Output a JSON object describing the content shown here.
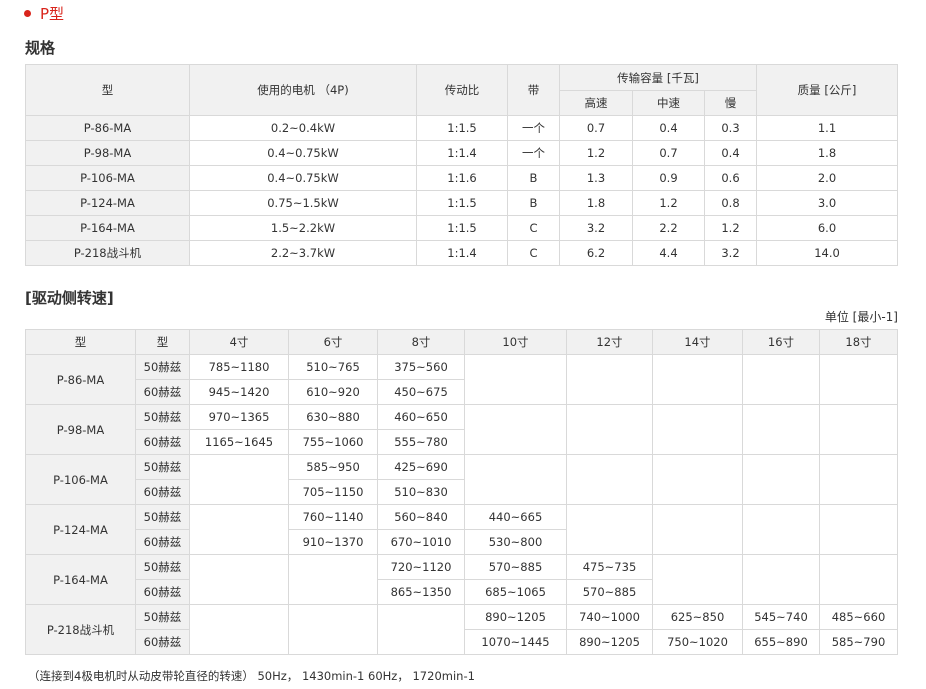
{
  "page_type_label": "P型",
  "spec_title": "规格",
  "spec_table": {
    "headers": {
      "model": "型",
      "motor": "使用的电机 （4P)",
      "ratio": "传动比",
      "belt": "带",
      "capacity": "传输容量 [千瓦]",
      "high": "高速",
      "mid": "中速",
      "low": "慢",
      "mass": "质量 [公斤]"
    },
    "rows": [
      {
        "model": "P-86-MA",
        "motor": "0.2~0.4kW",
        "ratio": "1:1.5",
        "belt": "一个",
        "high": "0.7",
        "mid": "0.4",
        "low": "0.3",
        "mass": "1.1"
      },
      {
        "model": "P-98-MA",
        "motor": "0.4~0.75kW",
        "ratio": "1:1.4",
        "belt": "一个",
        "high": "1.2",
        "mid": "0.7",
        "low": "0.4",
        "mass": "1.8"
      },
      {
        "model": "P-106-MA",
        "motor": "0.4~0.75kW",
        "ratio": "1:1.6",
        "belt": "B",
        "high": "1.3",
        "mid": "0.9",
        "low": "0.6",
        "mass": "2.0"
      },
      {
        "model": "P-124-MA",
        "motor": "0.75~1.5kW",
        "ratio": "1:1.5",
        "belt": "B",
        "high": "1.8",
        "mid": "1.2",
        "low": "0.8",
        "mass": "3.0"
      },
      {
        "model": "P-164-MA",
        "motor": "1.5~2.2kW",
        "ratio": "1:1.5",
        "belt": "C",
        "high": "3.2",
        "mid": "2.2",
        "low": "1.2",
        "mass": "6.0"
      },
      {
        "model": "P-218战斗机",
        "motor": "2.2~3.7kW",
        "ratio": "1:1.4",
        "belt": "C",
        "high": "6.2",
        "mid": "4.4",
        "low": "3.2",
        "mass": "14.0"
      }
    ]
  },
  "speed_title": "[驱动侧转速]",
  "speed_unit": "单位 [最小-1]",
  "speed_table": {
    "headers": [
      "型",
      "型",
      "4寸",
      "6寸",
      "8寸",
      "10寸",
      "12寸",
      "14寸",
      "16寸",
      "18寸"
    ],
    "models": [
      {
        "model": "P-86-MA",
        "rows": [
          {
            "freq": "50赫兹",
            "v": [
              "785~1180",
              "510~765",
              "375~560",
              "",
              "",
              "",
              "",
              ""
            ]
          },
          {
            "freq": "60赫兹",
            "v": [
              "945~1420",
              "610~920",
              "450~675",
              "",
              "",
              "",
              "",
              ""
            ]
          }
        ]
      },
      {
        "model": "P-98-MA",
        "rows": [
          {
            "freq": "50赫兹",
            "v": [
              "970~1365",
              "630~880",
              "460~650",
              "",
              "",
              "",
              "",
              ""
            ]
          },
          {
            "freq": "60赫兹",
            "v": [
              "1165~1645",
              "755~1060",
              "555~780",
              "",
              "",
              "",
              "",
              ""
            ]
          }
        ]
      },
      {
        "model": "P-106-MA",
        "rows": [
          {
            "freq": "50赫兹",
            "v": [
              "",
              "585~950",
              "425~690",
              "",
              "",
              "",
              "",
              ""
            ]
          },
          {
            "freq": "60赫兹",
            "v": [
              "",
              "705~1150",
              "510~830",
              "",
              "",
              "",
              "",
              ""
            ]
          }
        ]
      },
      {
        "model": "P-124-MA",
        "rows": [
          {
            "freq": "50赫兹",
            "v": [
              "",
              "760~1140",
              "560~840",
              "440~665",
              "",
              "",
              "",
              ""
            ]
          },
          {
            "freq": "60赫兹",
            "v": [
              "",
              "910~1370",
              "670~1010",
              "530~800",
              "",
              "",
              "",
              ""
            ]
          }
        ]
      },
      {
        "model": "P-164-MA",
        "rows": [
          {
            "freq": "50赫兹",
            "v": [
              "",
              "",
              "720~1120",
              "570~885",
              "475~735",
              "",
              "",
              ""
            ]
          },
          {
            "freq": "60赫兹",
            "v": [
              "",
              "",
              "865~1350",
              "685~1065",
              "570~885",
              "",
              "",
              ""
            ]
          }
        ]
      },
      {
        "model": "P-218战斗机",
        "rows": [
          {
            "freq": "50赫兹",
            "v": [
              "",
              "",
              "",
              "890~1205",
              "740~1000",
              "625~850",
              "545~740",
              "485~660"
            ]
          },
          {
            "freq": "60赫兹",
            "v": [
              "",
              "",
              "",
              "1070~1445",
              "890~1205",
              "750~1020",
              "655~890",
              "585~790"
            ]
          }
        ]
      }
    ]
  },
  "footnote": "（连接到4极电机时从动皮带轮直径的转速） 50Hz， 1430min-1 60Hz， 1720min-1"
}
